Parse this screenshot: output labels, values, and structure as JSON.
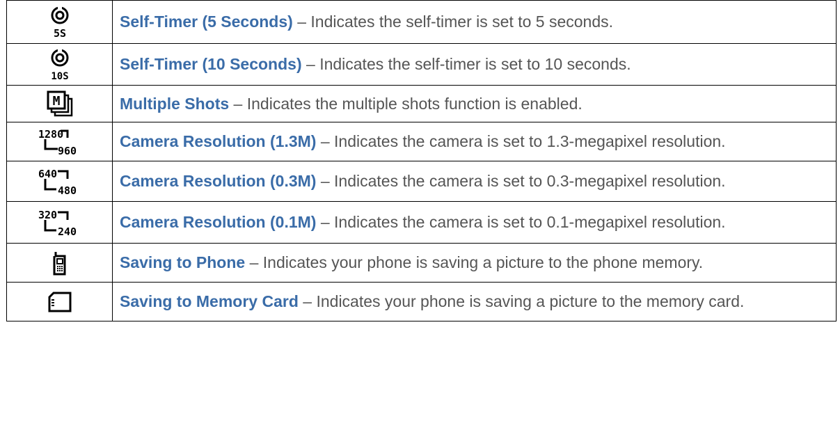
{
  "rows": [
    {
      "icon": "self-timer-5s-icon",
      "icon_text": "5S",
      "term": "Self-Timer (5 Seconds)",
      "dash": " – ",
      "description": "Indicates the self-timer is set to 5 seconds."
    },
    {
      "icon": "self-timer-10s-icon",
      "icon_text": "10S",
      "term": "Self-Timer (10 Seconds)",
      "dash": " – ",
      "description": "Indicates the self-timer is set to 10 seconds."
    },
    {
      "icon": "multiple-shots-icon",
      "icon_text": "M",
      "term": "Multiple Shots",
      "dash": " – ",
      "description": "Indicates the multiple shots function is enabled."
    },
    {
      "icon": "resolution-1280x960-icon",
      "icon_top": "1280",
      "icon_bottom": "960",
      "term": "Camera Resolution (1.3M)",
      "dash": " – ",
      "description": "Indicates the camera is set to 1.3-megapixel resolution."
    },
    {
      "icon": "resolution-640x480-icon",
      "icon_top": "640",
      "icon_bottom": "480",
      "term": "Camera Resolution (0.3M)",
      "dash": " – ",
      "description": "Indicates the camera is set to 0.3-megapixel resolution."
    },
    {
      "icon": "resolution-320x240-icon",
      "icon_top": "320",
      "icon_bottom": "240",
      "term": "Camera Resolution (0.1M)",
      "dash": " – ",
      "description": "Indicates the camera is set to 0.1-megapixel resolution."
    },
    {
      "icon": "phone-icon",
      "term": "Saving to Phone",
      "dash": " – ",
      "description": "Indicates your phone is saving a picture to the phone memory."
    },
    {
      "icon": "memory-card-icon",
      "term": "Saving to Memory Card",
      "dash": " – ",
      "description": "Indicates your phone is saving a picture to the memory card."
    }
  ]
}
